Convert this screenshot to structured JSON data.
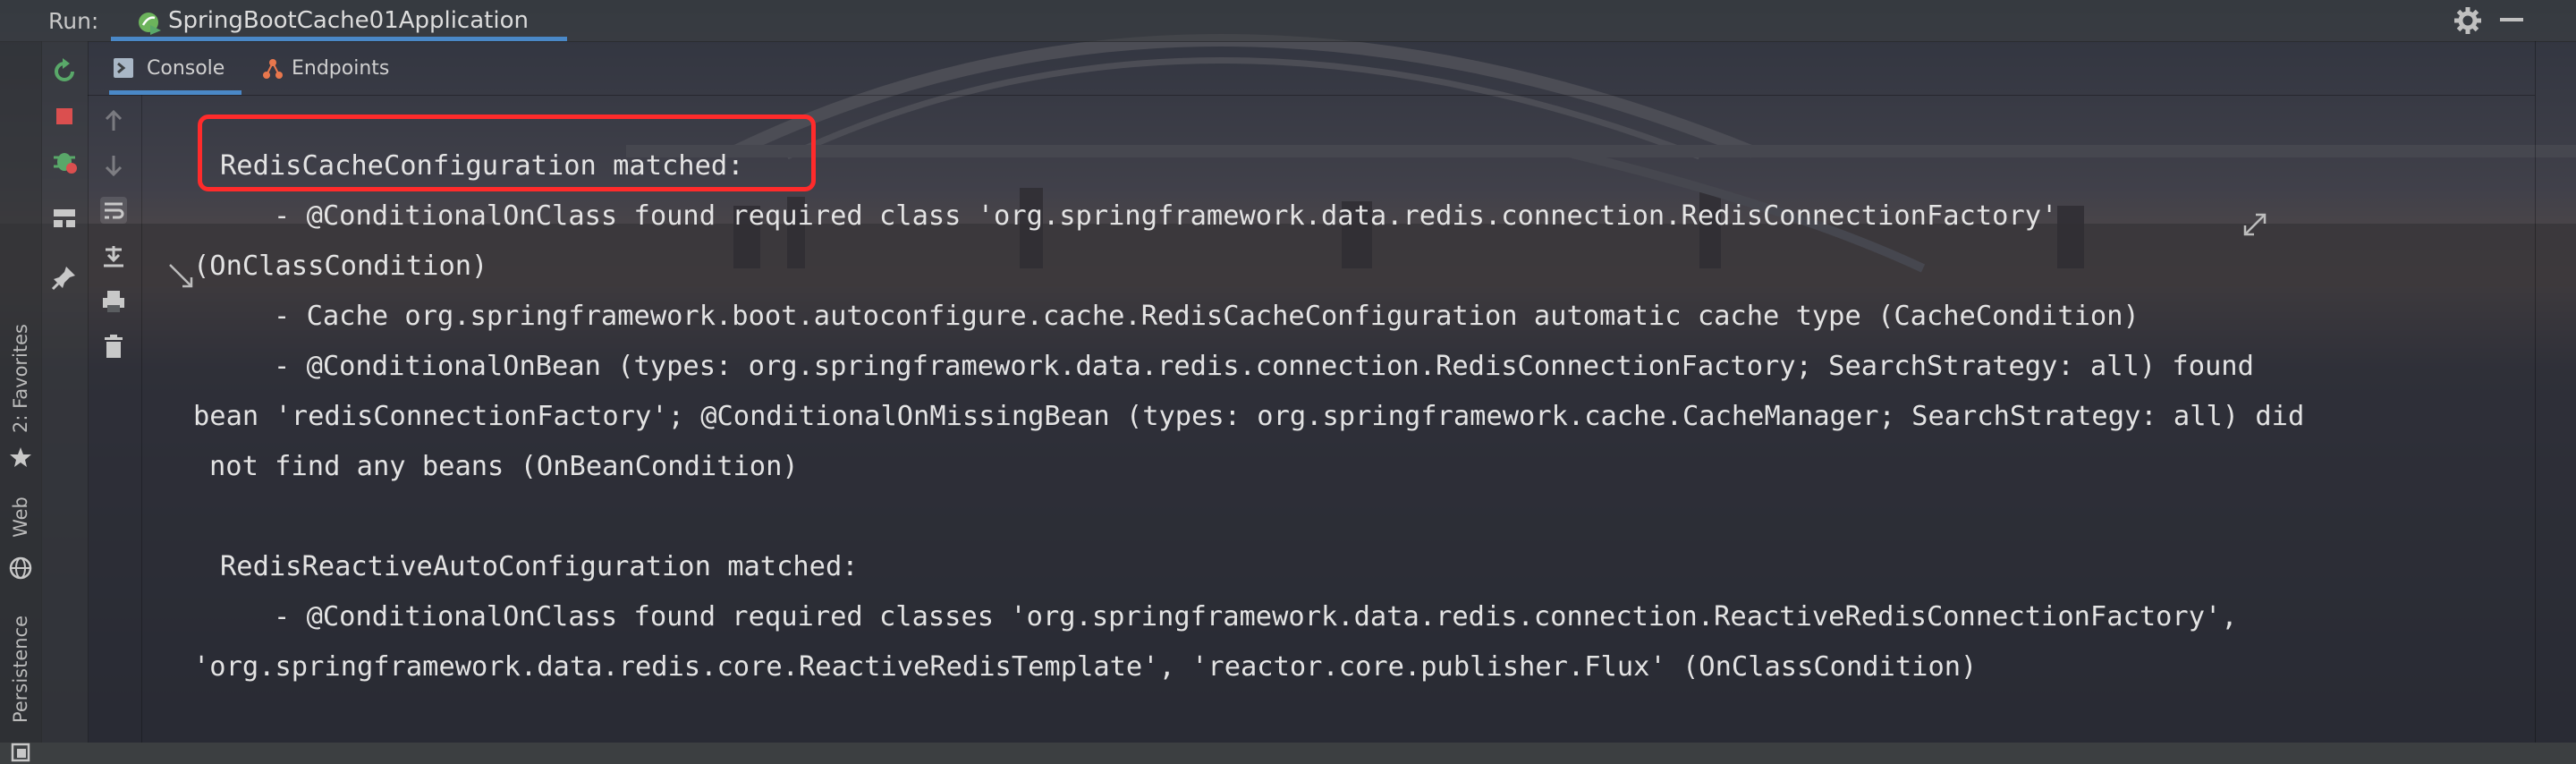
{
  "run_bar": {
    "label": "Run:",
    "tab_title": "SpringBootCache01Application"
  },
  "sub_tabs": {
    "console": "Console",
    "endpoints": "Endpoints"
  },
  "side_tabs": {
    "favorites": "2: Favorites",
    "web": "Web",
    "persistence": "Persistence"
  },
  "console": {
    "lines": [
      "RedisCacheConfiguration matched:",
      "- @ConditionalOnClass found required class 'org.springframework.data.redis.connection.RedisConnectionFactory'",
      "(OnClassCondition)",
      "- Cache org.springframework.boot.autoconfigure.cache.RedisCacheConfiguration automatic cache type (CacheCondition)",
      "- @ConditionalOnBean (types: org.springframework.data.redis.connection.RedisConnectionFactory; SearchStrategy: all) found",
      "bean 'redisConnectionFactory'; @ConditionalOnMissingBean (types: org.springframework.cache.CacheManager; SearchStrategy: all) did",
      "not find any beans (OnBeanCondition)",
      "RedisReactiveAutoConfiguration matched:",
      "- @ConditionalOnClass found required classes 'org.springframework.data.redis.connection.ReactiveRedisConnectionFactory',",
      "'org.springframework.data.redis.core.ReactiveRedisTemplate', 'reactor.core.publisher.Flux' (OnClassCondition)"
    ]
  },
  "colors": {
    "accent_underline": "#4a88c7",
    "highlight_box": "#ff2b2b",
    "rerun_green": "#59a869",
    "stop_red": "#db4f4f"
  },
  "icons": {
    "app": "spring-boot-run-icon",
    "settings": "gear-icon",
    "hide": "minimize-icon",
    "console_tab": "console-icon",
    "endpoints_tab": "endpoints-icon"
  }
}
